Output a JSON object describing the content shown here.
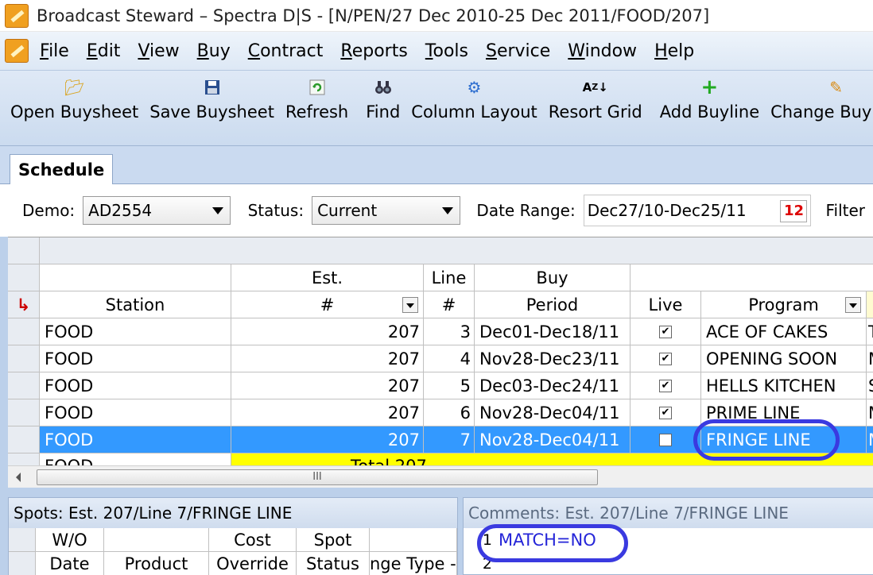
{
  "window": {
    "title": "Broadcast Steward – Spectra D|S - [N/PEN/27 Dec 2010-25 Dec 2011/FOOD/207]"
  },
  "menu": [
    "File",
    "Edit",
    "View",
    "Buy",
    "Contract",
    "Reports",
    "Tools",
    "Service",
    "Window",
    "Help"
  ],
  "toolbar": {
    "open": "Open Buysheet",
    "save": "Save Buysheet",
    "refresh": "Refresh",
    "find": "Find",
    "column_layout": "Column Layout",
    "resort": "Resort Grid",
    "add_buyline": "Add Buyline",
    "change_buyline": "Change Buyline"
  },
  "tab": {
    "schedule": "Schedule"
  },
  "filters": {
    "demo_label": "Demo:",
    "demo_value": "AD2554",
    "status_label": "Status:",
    "status_value": "Current",
    "date_label": "Date Range:",
    "date_value": "Dec27/10-Dec25/11",
    "filter_label": "Filter",
    "calendar_glyph": "12"
  },
  "grid": {
    "headers": {
      "station": "Station",
      "est_top": "Est.",
      "est_bottom": "#",
      "line_top": "Line",
      "line_bottom": "#",
      "buy_top": "Buy",
      "buy_bottom": "Period",
      "live": "Live",
      "program": "Program"
    },
    "rows": [
      {
        "station": "FOOD",
        "est": "207",
        "line": "3",
        "period": "Dec01-Dec18/11",
        "live": "✔",
        "program": "ACE OF CAKES",
        "extra": "T"
      },
      {
        "station": "FOOD",
        "est": "207",
        "line": "4",
        "period": "Nov28-Dec23/11",
        "live": "✔",
        "program": "OPENING SOON",
        "extra": "M"
      },
      {
        "station": "FOOD",
        "est": "207",
        "line": "5",
        "period": "Dec03-Dec24/11",
        "live": "✔",
        "program": "HELLS KITCHEN",
        "extra": "S"
      },
      {
        "station": "FOOD",
        "est": "207",
        "line": "6",
        "period": "Nov28-Dec04/11",
        "live": "✔",
        "program": "PRIME LINE",
        "extra": "M"
      },
      {
        "station": "FOOD",
        "est": "207",
        "line": "7",
        "period": "Nov28-Dec04/11",
        "live": "✔",
        "program": "FRINGE  LINE",
        "extra": "M"
      }
    ],
    "partial_row": {
      "station": "FOOD",
      "est": "Total 207"
    },
    "scroll_grip": "III"
  },
  "spots_pane": {
    "title": "Spots: Est. 207/Line 7/FRINGE  LINE",
    "col_wo_top": "W/O",
    "col_wo_bottom": "Date",
    "col_product": "Product",
    "col_cost_top": "Cost",
    "col_cost_bottom": "Override",
    "col_spot_top": "Spot",
    "col_spot_bottom": "Status",
    "col_change": "nge Type -"
  },
  "comments_pane": {
    "title": "Comments: Est. 207/Line 7/FRINGE  LINE",
    "lines": [
      {
        "num": "1",
        "text": "MATCH=NO"
      },
      {
        "num": "2",
        "text": ""
      }
    ]
  },
  "colors": {
    "selection": "#3399ff",
    "highlight_oval": "#3a3ae0",
    "total_row": "#ffff00"
  }
}
